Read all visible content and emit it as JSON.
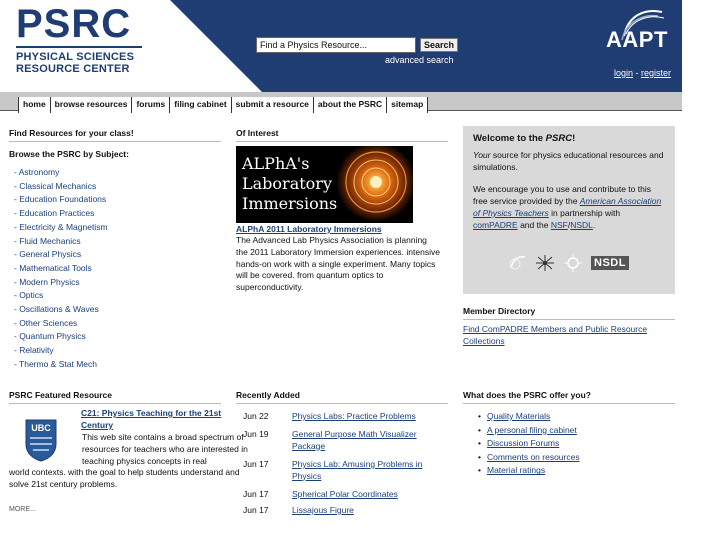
{
  "header": {
    "logo_big": "PSRC",
    "logo_line1": "PHYSICAL SCIENCES",
    "logo_line2": "RESOURCE CENTER",
    "search_placeholder": "Find a Physics Resource...",
    "search_button": "Search",
    "advanced_search": "advanced search",
    "aapt_logo": "AAPT",
    "login": "login",
    "separator": " - ",
    "register": "register"
  },
  "nav": {
    "items": [
      "home",
      "browse resources",
      "forums",
      "filing cabinet",
      "submit a resource",
      "about the PSRC",
      "sitemap"
    ]
  },
  "left": {
    "heading": "Find Resources for your class!",
    "subheading": "Browse the PSRC by Subject:",
    "subjects": [
      "- Astronomy",
      "- Classical Mechanics",
      "- Education Foundations",
      "- Education Practices",
      "- Electricity & Magnetism",
      "- Fluid Mechanics",
      "- General Physics",
      "- Mathematical Tools",
      "- Modern Physics",
      "- Optics",
      "- Oscillations & Waves",
      "- Other Sciences",
      "- Quantum Physics",
      "- Relativity",
      "- Thermo & Stat Mech"
    ]
  },
  "interest": {
    "heading": "Of Interest",
    "image_line1": "ALPhA's",
    "image_line2": "Laboratory",
    "image_line3": "Immersions",
    "link": "ALPhA 2011 Laboratory Immersions",
    "description": "The Advanced Lab Physics Association is planning the 2011 Laboratory Immersion experiences. intensive hands-on work with a single experiment. Many topics will be covered. from quantum optics to superconductivity."
  },
  "welcome": {
    "title_prefix": "Welcome to the ",
    "title_em": "PSRC",
    "title_suffix": "!",
    "p1_em": "Your",
    "p1_rest": " source for physics educational resources and simulations.",
    "p2_a": "We encourage you to use and contribute to this free service provided by the ",
    "p2_link1": "American Association of Physics Teachers",
    "p2_b": " in partnership with ",
    "p2_link2": "comPADRE",
    "p2_c": " and the ",
    "p2_link3": "NSF",
    "p2_slash": "/",
    "p2_link4": "NSDL",
    "p2_d": ".",
    "nsdl_logo": "NSDL"
  },
  "member": {
    "heading": "Member Directory",
    "link": "Find ComPADRE Members and Public Resource Collections"
  },
  "featured": {
    "heading": "PSRC Featured Resource",
    "logo_text": "UBC",
    "title": "C21: Physics Teaching for the 21st Century",
    "desc_indented": "This web site contains a broad spectrum of resources for teachers who are interested in teaching physics concepts in real",
    "desc_full": "world contexts. with the goal to help students understand and solve 21st century problems.",
    "more": "MORE..."
  },
  "recent": {
    "heading": "Recently Added",
    "items": [
      {
        "date": "Jun 22",
        "title": "Physics Labs: Practice Problems"
      },
      {
        "date": "Jun 19",
        "title": "General Purpose Math Visualizer Package"
      },
      {
        "date": "Jun 17",
        "title": "Physics Lab: Amusing Problems in Physics"
      },
      {
        "date": "Jun 17",
        "title": "Spherical Polar Coordinates"
      },
      {
        "date": "Jun 17",
        "title": "Lissajous Figure"
      }
    ]
  },
  "offers": {
    "heading": "What does the PSRC offer you?",
    "items": [
      "Quality Materials",
      "A personal filing cabinet",
      "Discussion Forums",
      "Comments on resources",
      "Material ratings"
    ]
  },
  "colors": {
    "brand_blue": "#1f3c73",
    "link": "#1a3f7a",
    "nav_gray": "#c8c8c8",
    "welcome_bg": "#d9d9d9"
  }
}
